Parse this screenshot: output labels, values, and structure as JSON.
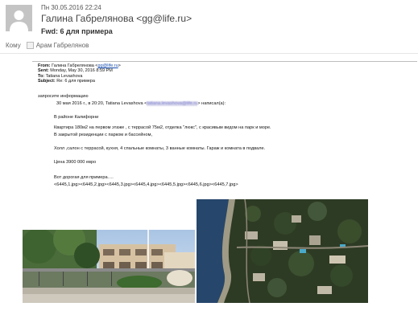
{
  "message": {
    "date": "Пн 30.05.2016 22:24",
    "from": "Галина Габрелянова <gg@life.ru>",
    "subject": "Fwd: 6 для примера",
    "to_label": "Кому",
    "to_recipient": "Арам Габрелянов"
  },
  "forward": {
    "from_label": "From:",
    "from_name": "Галина Габрелянова <",
    "from_email": "gg@life.ru",
    "from_tail": ">",
    "sent_label": "Sent:",
    "sent_value": "Monday, May 30, 2016 8:59 PM",
    "to_label": "To:",
    "to_value": "Tatiana Levashova",
    "subject_label": "Subject:",
    "subject_value": "Re: 6 для примера"
  },
  "body": {
    "intro": "запросите информацию",
    "quote_head_pre": "30 мая 2016 г., в 20:20, Tatiana Levashova <",
    "quote_head_email": "tatiana.levashova@life.ru",
    "quote_head_post": "> написал(а):",
    "line1": "В районе Калифорни",
    "line2": "Квартира 180м2 на первом этаже , с террасой 75м2, отделка \"люкс\", с красивым видом на парк и море.",
    "line3": "В закрытой резиденции с  парком и бассейном,",
    "line4": "Холл ,салон с террасой, кухня, 4 спальные комнаты, 3 ванные комнаты. Гараж и комната в подвале.",
    "line5": "Цена 3900 000 евро",
    "line6": "Вот дорогая для примера….",
    "line7": "<6445,1.jpg><6445,2.jpg><6445,3.jpg><6445,4.jpg><6445,5.jpg><6445,6.jpg><6445,7.jpg>"
  },
  "colors": {
    "link": "#1a4fb0",
    "avatar": "#bfbfbf"
  },
  "icons": {
    "avatar": "person-silhouette-icon",
    "recipient": "contact-icon"
  }
}
